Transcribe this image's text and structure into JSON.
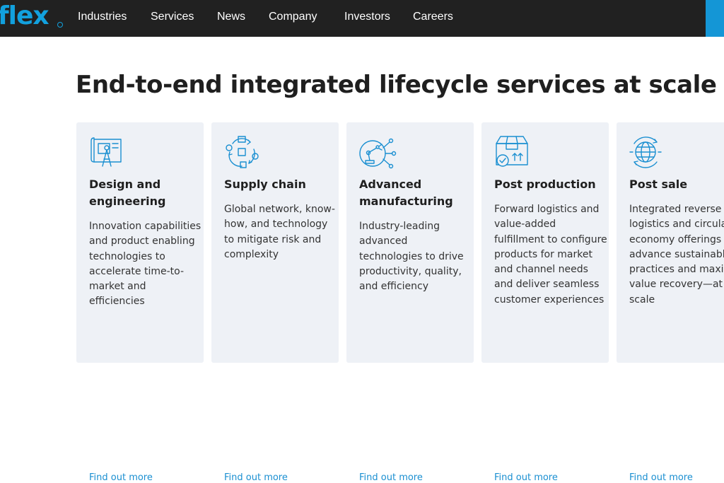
{
  "brand": {
    "logo_text": "flex",
    "accent_color": "#12a1de",
    "nav_bg": "#212121"
  },
  "nav": {
    "items": [
      {
        "label": "Industries"
      },
      {
        "label": "Services"
      },
      {
        "label": "News"
      },
      {
        "label": "Company"
      },
      {
        "label": "Investors"
      },
      {
        "label": "Careers"
      }
    ]
  },
  "hero": {
    "title": "End-to-end integrated lifecycle services at scale"
  },
  "cards": [
    {
      "icon": "drafting-blueprint-icon",
      "title": "Design and engineering",
      "description": "Innovation capabilities and product enabling technologies to accelerate time-to-market and efficiencies",
      "link": "Find out more"
    },
    {
      "icon": "supply-chain-cycle-icon",
      "title": "Supply chain",
      "description": "Global network, know-how, and technology to mitigate risk and complexity",
      "link": "Find out more"
    },
    {
      "icon": "robotic-arm-icon",
      "title": "Advanced manufacturing",
      "description": "Industry-leading advanced technologies to drive productivity, quality, and efficiency",
      "link": "Find out more"
    },
    {
      "icon": "package-box-icon",
      "title": "Post production",
      "description": "Forward logistics and value-added fulfillment to configure products for market and channel needs and deliver seamless customer experiences",
      "link": "Find out more"
    },
    {
      "icon": "recycling-globe-icon",
      "title": "Post sale",
      "description": "Integrated reverse logistics and circular economy offerings to advance sustainable practices and maximize value recovery—at scale",
      "link": "Find out more"
    }
  ]
}
